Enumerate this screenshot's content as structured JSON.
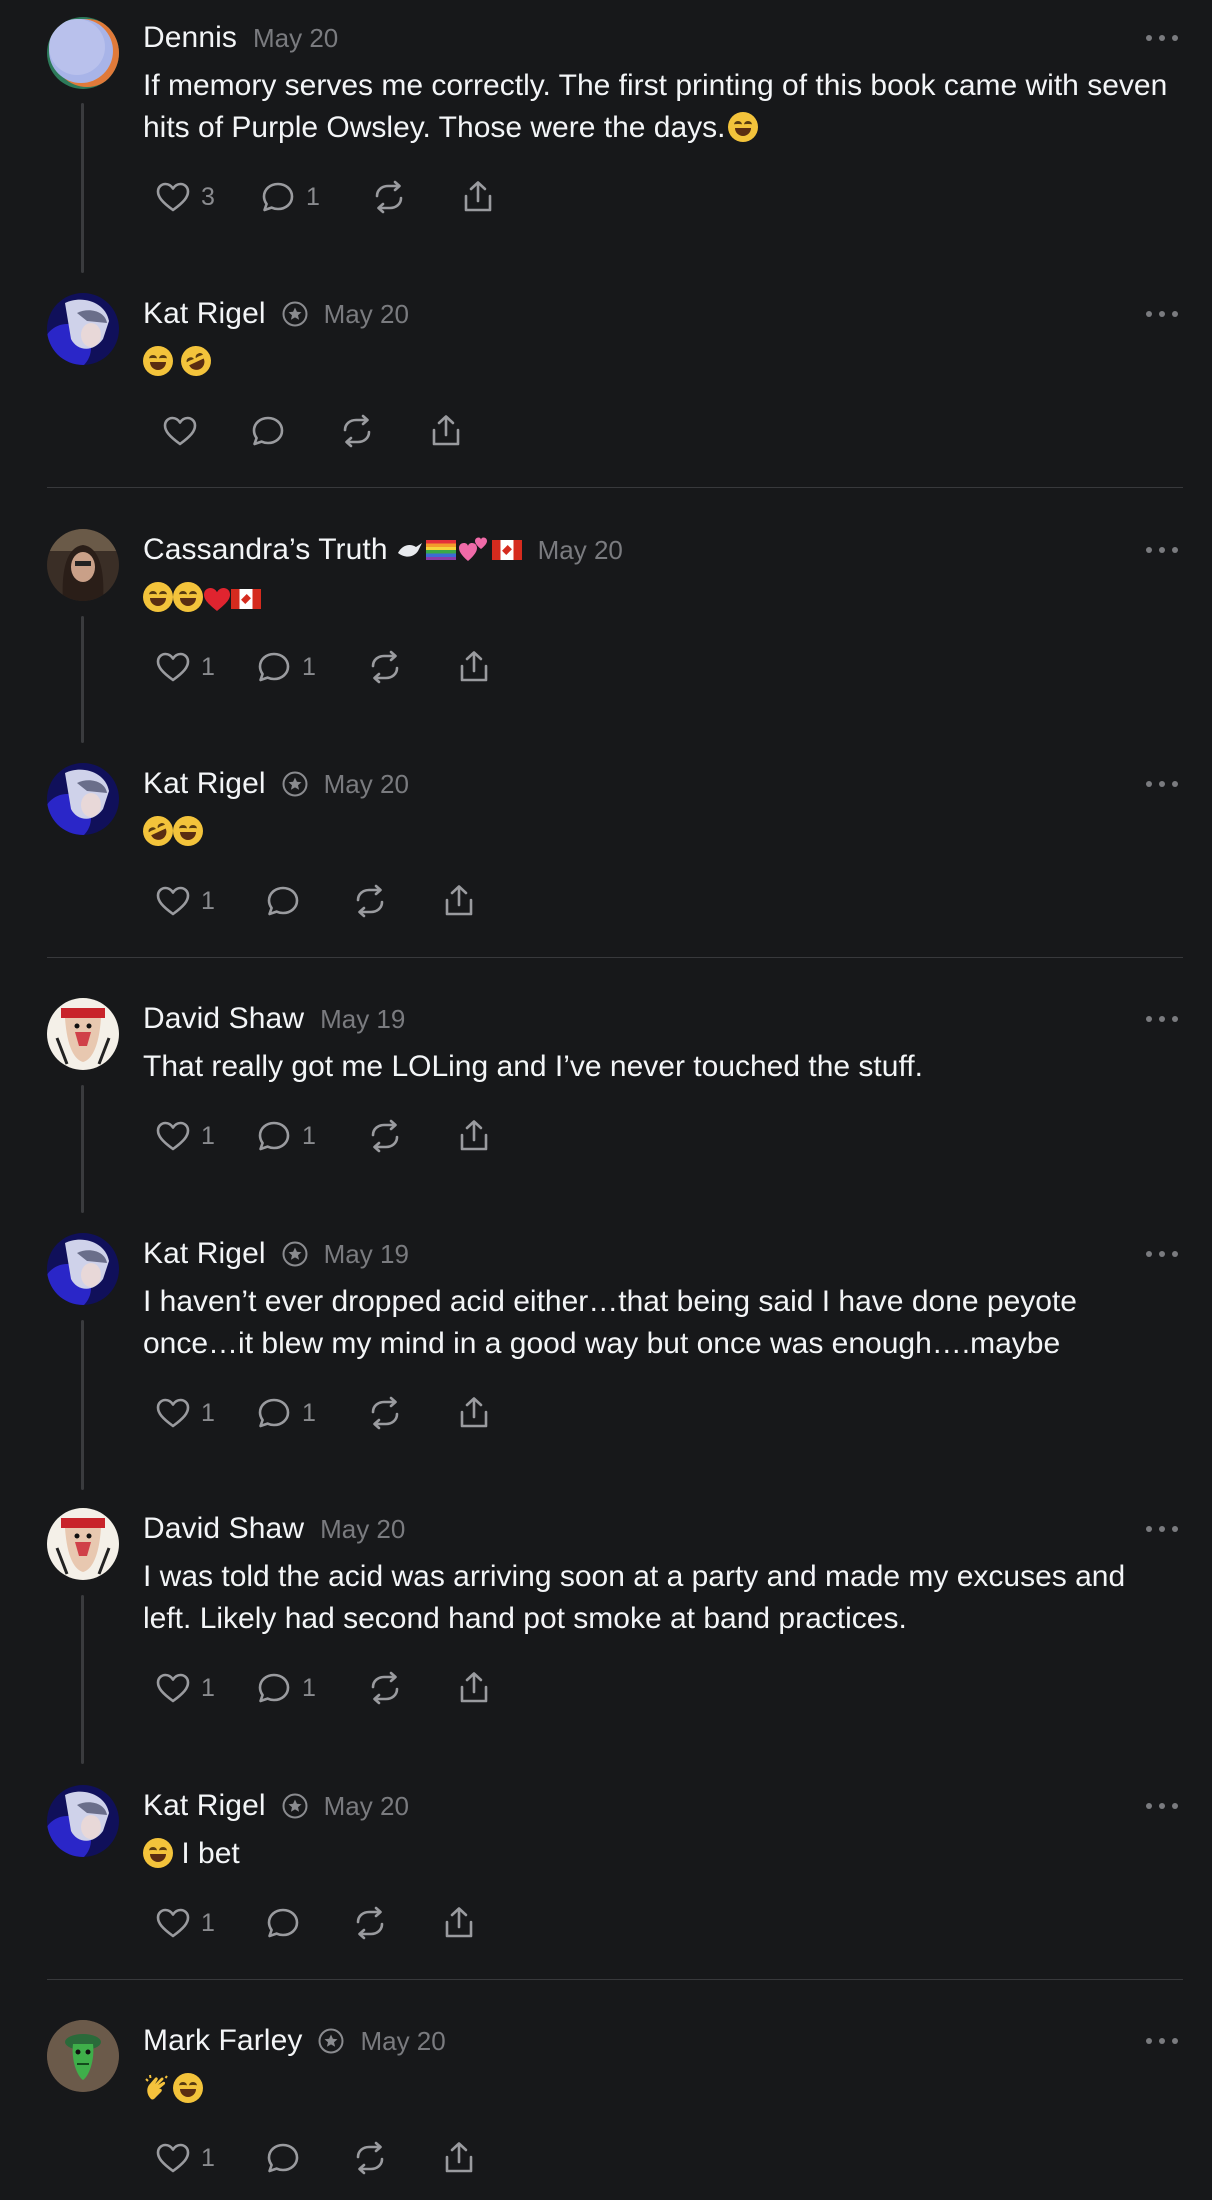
{
  "posts": [
    {
      "name": "Dennis",
      "date": "May 20",
      "text": "If memory serves me correctly. The first printing of this book came with seven hits of Purple Owsley. Those were the days.",
      "likes": "3",
      "replies": "1"
    },
    {
      "name": "Kat Rigel",
      "date": "May 20",
      "text": "",
      "likes": "",
      "replies": ""
    },
    {
      "name": "Cassandra’s Truth",
      "date": "May 20",
      "text": "",
      "likes": "1",
      "replies": "1"
    },
    {
      "name": "Kat Rigel",
      "date": "May 20",
      "text": "",
      "likes": "1",
      "replies": ""
    },
    {
      "name": "David Shaw",
      "date": "May 19",
      "text": "That really got me LOLing and I’ve never touched the stuff.",
      "likes": "1",
      "replies": "1"
    },
    {
      "name": "Kat Rigel",
      "date": "May 19",
      "text": "I haven’t ever dropped acid either…that being said I have done peyote once…it blew my mind in a good way but once was enough….maybe",
      "likes": "1",
      "replies": "1"
    },
    {
      "name": "David Shaw",
      "date": "May 20",
      "text": "I was told the acid was arriving soon at a party and made my excuses and left. Likely had second hand pot smoke at band practices.",
      "likes": "1",
      "replies": "1"
    },
    {
      "name": "Kat Rigel",
      "date": "May 20",
      "text": "I bet",
      "likes": "1",
      "replies": ""
    },
    {
      "name": "Mark Farley",
      "date": "May 20",
      "text": "",
      "likes": "1",
      "replies": ""
    }
  ],
  "icons": {
    "like": "heart-icon",
    "reply": "comment-icon",
    "repost": "repost-icon",
    "share": "share-icon",
    "more": "more-icon",
    "badge": "verified-badge-icon"
  },
  "colors": {
    "background": "#17181a",
    "text": "#f3f5f7",
    "muted": "#7a7b7f",
    "divider": "#38393c"
  }
}
